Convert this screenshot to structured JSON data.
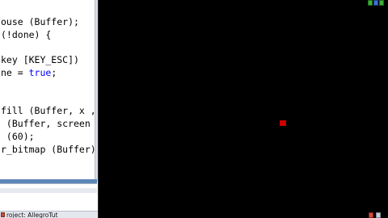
{
  "editor": {
    "code_lines": [
      {
        "before": "ouse (Buffer);",
        "keyword": "",
        "after": ""
      },
      {
        "before": "(!done) {",
        "keyword": "",
        "after": ""
      },
      {
        "before": "",
        "keyword": "",
        "after": ""
      },
      {
        "before": "key [KEY_ESC])",
        "keyword": "",
        "after": ""
      },
      {
        "before": "ne = ",
        "keyword": "true",
        "after": ";"
      },
      {
        "before": "",
        "keyword": "",
        "after": ""
      },
      {
        "before": "",
        "keyword": "",
        "after": ""
      },
      {
        "before": "fill (Buffer, x ,",
        "keyword": "",
        "after": ""
      },
      {
        "before": " (Buffer, screen",
        "keyword": "",
        "after": ""
      },
      {
        "before": " (60);",
        "keyword": "",
        "after": ""
      },
      {
        "before": "r_bitmap (Buffer)",
        "keyword": "",
        "after": ""
      }
    ]
  },
  "status_bar": {
    "text": "roject: AllegroTut"
  },
  "game": {
    "background": "#000000",
    "player_color": "#cc0000"
  },
  "colors": {
    "keyword": "#0000ff",
    "editor_band": "#5c86b8"
  }
}
